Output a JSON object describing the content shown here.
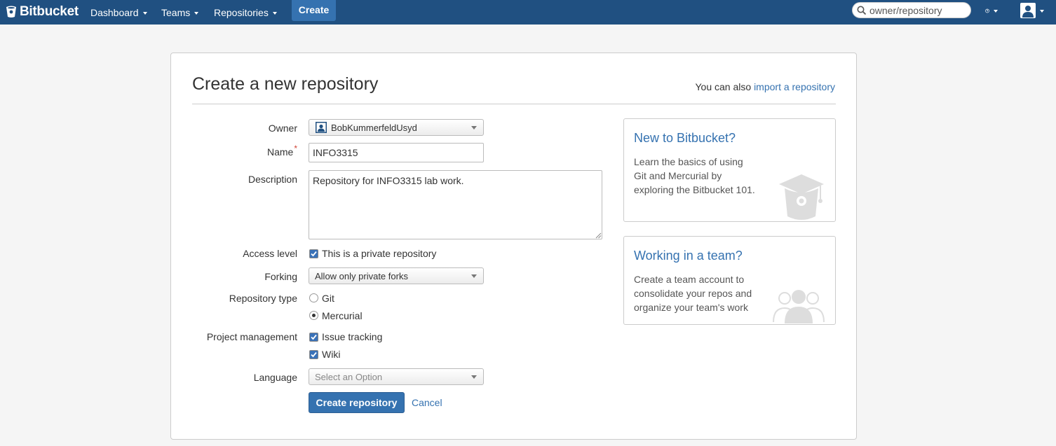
{
  "topbar": {
    "brand": "Bitbucket",
    "nav": [
      {
        "label": "Dashboard"
      },
      {
        "label": "Teams"
      },
      {
        "label": "Repositories"
      }
    ],
    "create_label": "Create",
    "search_placeholder": "owner/repository"
  },
  "page": {
    "title": "Create a new repository",
    "import_prefix": "You can also",
    "import_link": "import a repository"
  },
  "form": {
    "owner": {
      "label": "Owner",
      "value": "BobKummerfeldUsyd"
    },
    "name": {
      "label": "Name",
      "value": "INFO3315",
      "required_mark": "*"
    },
    "description": {
      "label": "Description",
      "value": "Repository for INFO3315 lab work."
    },
    "access": {
      "label": "Access level",
      "option": "This is a private repository",
      "checked": true
    },
    "forking": {
      "label": "Forking",
      "value": "Allow only private forks"
    },
    "repo_type": {
      "label": "Repository type",
      "options": [
        {
          "label": "Git",
          "selected": false
        },
        {
          "label": "Mercurial",
          "selected": true
        }
      ]
    },
    "project_management": {
      "label": "Project management",
      "options": [
        {
          "label": "Issue tracking",
          "checked": true
        },
        {
          "label": "Wiki",
          "checked": true
        }
      ]
    },
    "language": {
      "label": "Language",
      "placeholder": "Select an Option"
    },
    "submit_label": "Create repository",
    "cancel_label": "Cancel"
  },
  "sidebar": {
    "boxes": [
      {
        "title": "New to Bitbucket?",
        "text": "Learn the basics of using Git and Mercurial by exploring the Bitbucket 101.",
        "icon": "graduation-bucket-icon"
      },
      {
        "title": "Working in a team?",
        "text": "Create a team account to consolidate your repos and organize your team's work",
        "icon": "team-icon"
      }
    ]
  },
  "colors": {
    "header_bg": "#205081",
    "primary": "#3572b0",
    "link": "#3572b0",
    "required": "#d04437"
  }
}
